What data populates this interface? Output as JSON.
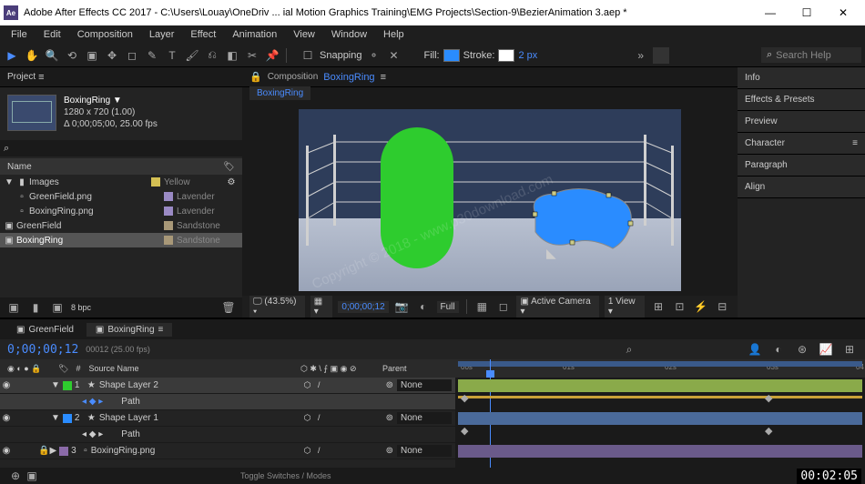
{
  "window": {
    "app_badge": "Ae",
    "title": "Adobe After Effects CC 2017 - C:\\Users\\Louay\\OneDriv ... ial Motion Graphics Training\\EMG Projects\\Section-9\\BezierAnimation 3.aep *",
    "min": "—",
    "max": "☐",
    "close": "✕"
  },
  "menu": [
    "File",
    "Edit",
    "Composition",
    "Layer",
    "Effect",
    "Animation",
    "View",
    "Window",
    "Help"
  ],
  "toolbar": {
    "snapping": "Snapping",
    "fill_label": "Fill:",
    "fill_color": "#2a8cff",
    "stroke_label": "Stroke:",
    "stroke_color": "#ffffff",
    "stroke_px": "2 px",
    "search_placeholder": "Search Help"
  },
  "project": {
    "panel_title": "Project",
    "comp_name": "BoxingRing ▼",
    "comp_res": "1280 x 720 (1.00)",
    "comp_dur": "Δ 0;00;05;00, 25.00 fps",
    "col_name": "Name",
    "items": [
      {
        "label": "Images",
        "type": "",
        "tag": "yellow",
        "type_text": "Yellow",
        "indent": 0,
        "folder": true
      },
      {
        "label": "GreenField.png",
        "type_text": "Lavender",
        "tag": "lav",
        "indent": 1
      },
      {
        "label": "BoxingRing.png",
        "type_text": "Lavender",
        "tag": "lav",
        "indent": 1
      },
      {
        "label": "GreenField",
        "type_text": "Sandstone",
        "tag": "sand",
        "indent": 0,
        "comp": true
      },
      {
        "label": "BoxingRing",
        "type_text": "Sandstone",
        "tag": "sand",
        "indent": 0,
        "comp": true,
        "sel": true
      }
    ],
    "footer_bpc": "8 bpc"
  },
  "comp": {
    "crumb_prefix": "Composition",
    "crumb_name": "BoxingRing",
    "flow_tab": "BoxingRing",
    "zoom": "(43.5%)",
    "time": "0;00;00;12",
    "res": "Full",
    "camera": "Active Camera",
    "views": "1 View"
  },
  "right_panels": [
    "Info",
    "Effects & Presets",
    "Preview",
    "Character",
    "Paragraph",
    "Align"
  ],
  "timeline": {
    "tabs": [
      {
        "label": "GreenField",
        "active": false
      },
      {
        "label": "BoxingRing",
        "active": true
      }
    ],
    "timecode": "0;00;00;12",
    "frame_info": "00012 (25.00 fps)",
    "head_source": "Source Name",
    "head_parent": "Parent",
    "none": "None",
    "layers": [
      {
        "num": "1",
        "name": "Shape Layer 2",
        "color": "#2ecc2e",
        "sel": true,
        "star": true
      },
      {
        "num": "",
        "name": "Path",
        "color": "",
        "sub": true
      },
      {
        "num": "2",
        "name": "Shape Layer 1",
        "color": "#2a8cff",
        "star": true
      },
      {
        "num": "",
        "name": "Path",
        "color": "",
        "sub": true
      },
      {
        "num": "3",
        "name": "BoxingRing.png",
        "color": "#8a6aa8",
        "img": true
      }
    ],
    "ruler": [
      "00s",
      "01s",
      "02s",
      "03s",
      "04"
    ],
    "toggle": "Toggle Switches / Modes"
  },
  "status_time": "00:02:05",
  "watermark": "Copyright © 2018 - www.p30download.com"
}
